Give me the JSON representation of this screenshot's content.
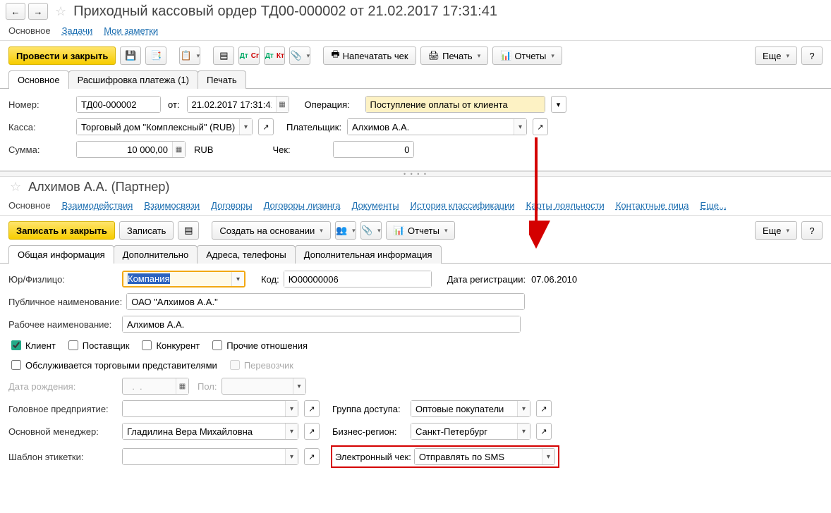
{
  "top": {
    "title": "Приходный кассовый ордер ТД00-000002 от 21.02.2017 17:31:41",
    "nav": {
      "main": "Основное",
      "tasks": "Задачи",
      "notes": "Мои заметки"
    },
    "toolbar": {
      "post_close": "Провести и закрыть",
      "print_check": "Напечатать чек",
      "print": "Печать",
      "reports": "Отчеты",
      "more": "Еще"
    },
    "tabs": {
      "main": "Основное",
      "decipher": "Расшифровка платежа (1)",
      "print": "Печать"
    },
    "form": {
      "number_label": "Номер:",
      "number_value": "ТД00-000002",
      "from_label": "от:",
      "from_value": "21.02.2017 17:31:41",
      "operation_label": "Операция:",
      "operation_value": "Поступление оплаты от клиента",
      "cash_label": "Касса:",
      "cash_value": "Торговый дом \"Комплексный\" (RUB)",
      "payer_label": "Плательщик:",
      "payer_value": "Алхимов А.А.",
      "sum_label": "Сумма:",
      "sum_value": "10 000,00",
      "currency": "RUB",
      "check_label": "Чек:",
      "check_value": "0"
    }
  },
  "bottom": {
    "title": "Алхимов А.А. (Партнер)",
    "nav": {
      "main": "Основное",
      "interactions": "Взаимодействия",
      "relations": "Взаимосвязи",
      "contracts": "Договоры",
      "leasing": "Договоры лизинга",
      "documents": "Документы",
      "history": "История классификации",
      "loyalty": "Карты лояльности",
      "contacts": "Контактные лица",
      "more": "Еще..."
    },
    "toolbar": {
      "write_close": "Записать и закрыть",
      "write": "Записать",
      "create_based": "Создать на основании",
      "reports": "Отчеты",
      "more": "Еще"
    },
    "tabs": {
      "general": "Общая информация",
      "additional": "Дополнительно",
      "addresses": "Адреса, телефоны",
      "extra": "Дополнительная информация"
    },
    "form": {
      "type_label": "Юр/Физлицо:",
      "type_value": "Компания",
      "code_label": "Код:",
      "code_value": "Ю00000006",
      "regdate_label": "Дата регистрации:",
      "regdate_value": "07.06.2010",
      "pubname_label": "Публичное наименование:",
      "pubname_value": "ОАО \"Алхимов А.А.\"",
      "workname_label": "Рабочее наименование:",
      "workname_value": "Алхимов А.А.",
      "cb_client": "Клиент",
      "cb_supplier": "Поставщик",
      "cb_competitor": "Конкурент",
      "cb_other": "Прочие отношения",
      "cb_served": "Обслуживается торговыми представителями",
      "cb_carrier": "Перевозчик",
      "birthday_label": "Дата рождения:",
      "birthday_value": "  .  .",
      "gender_label": "Пол:",
      "gender_value": "",
      "headorg_label": "Головное предприятие:",
      "headorg_value": "",
      "group_label": "Группа доступа:",
      "group_value": "Оптовые покупатели",
      "manager_label": "Основной менеджер:",
      "manager_value": "Гладилина Вера Михайловна",
      "region_label": "Бизнес-регион:",
      "region_value": "Санкт-Петербург",
      "template_label": "Шаблон этикетки:",
      "template_value": "",
      "echeck_label": "Электронный чек:",
      "echeck_value": "Отправлять по SMS"
    }
  }
}
